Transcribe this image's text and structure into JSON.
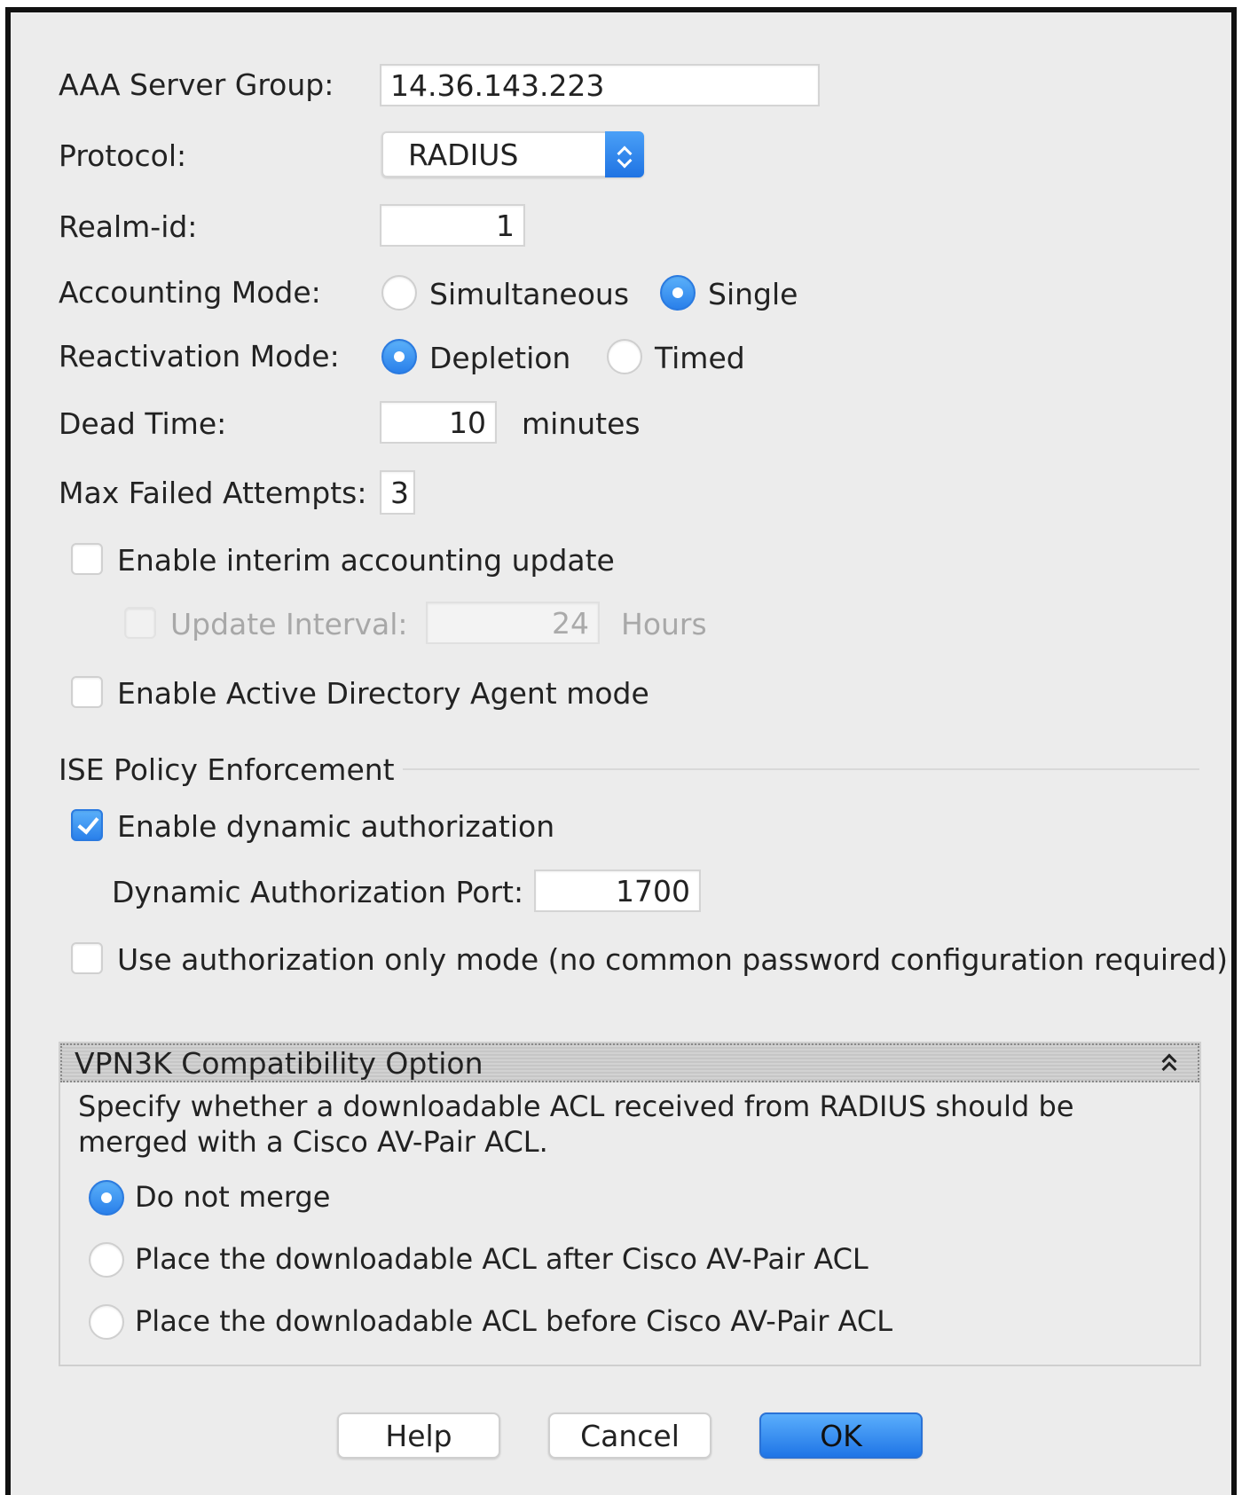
{
  "form": {
    "aaa_server_group_label": "AAA Server Group:",
    "aaa_server_group_value": "14.36.143.223",
    "protocol_label": "Protocol:",
    "protocol_value": "RADIUS",
    "realm_id_label": "Realm-id:",
    "realm_id_value": "1",
    "accounting_mode_label": "Accounting Mode:",
    "accounting_options": [
      {
        "label": "Simultaneous",
        "selected": false
      },
      {
        "label": "Single",
        "selected": true
      }
    ],
    "reactivation_mode_label": "Reactivation Mode:",
    "reactivation_options": [
      {
        "label": "Depletion",
        "selected": true
      },
      {
        "label": "Timed",
        "selected": false
      }
    ],
    "dead_time_label": "Dead Time:",
    "dead_time_value": "10",
    "dead_time_unit": "minutes",
    "max_failed_label": "Max Failed Attempts:",
    "max_failed_value": "3",
    "interim_accounting_label": "Enable interim accounting update",
    "interim_accounting_checked": false,
    "update_interval_label": "Update Interval:",
    "update_interval_value": "24",
    "update_interval_unit": "Hours",
    "ad_agent_label": "Enable Active Directory Agent mode",
    "ad_agent_checked": false
  },
  "ise": {
    "section_title": "ISE Policy Enforcement",
    "dynamic_auth_label": "Enable dynamic authorization",
    "dynamic_auth_checked": true,
    "dynamic_auth_port_label": "Dynamic Authorization Port:",
    "dynamic_auth_port_value": "1700",
    "auth_only_label": "Use authorization only mode (no common password configuration required)",
    "auth_only_checked": false
  },
  "vpn3k": {
    "title": "VPN3K Compatibility Option",
    "description_line1": "Specify whether a downloadable ACL received from RADIUS should be",
    "description_line2": "merged with a Cisco AV-Pair ACL.",
    "options": [
      {
        "label": "Do not merge",
        "selected": true
      },
      {
        "label": "Place the downloadable ACL after Cisco AV-Pair ACL",
        "selected": false
      },
      {
        "label": "Place the downloadable ACL before Cisco AV-Pair ACL",
        "selected": false
      }
    ]
  },
  "buttons": {
    "help": "Help",
    "cancel": "Cancel",
    "ok": "OK"
  },
  "colors": {
    "accent": "#2a80ea",
    "dialog_bg": "#ececec"
  }
}
